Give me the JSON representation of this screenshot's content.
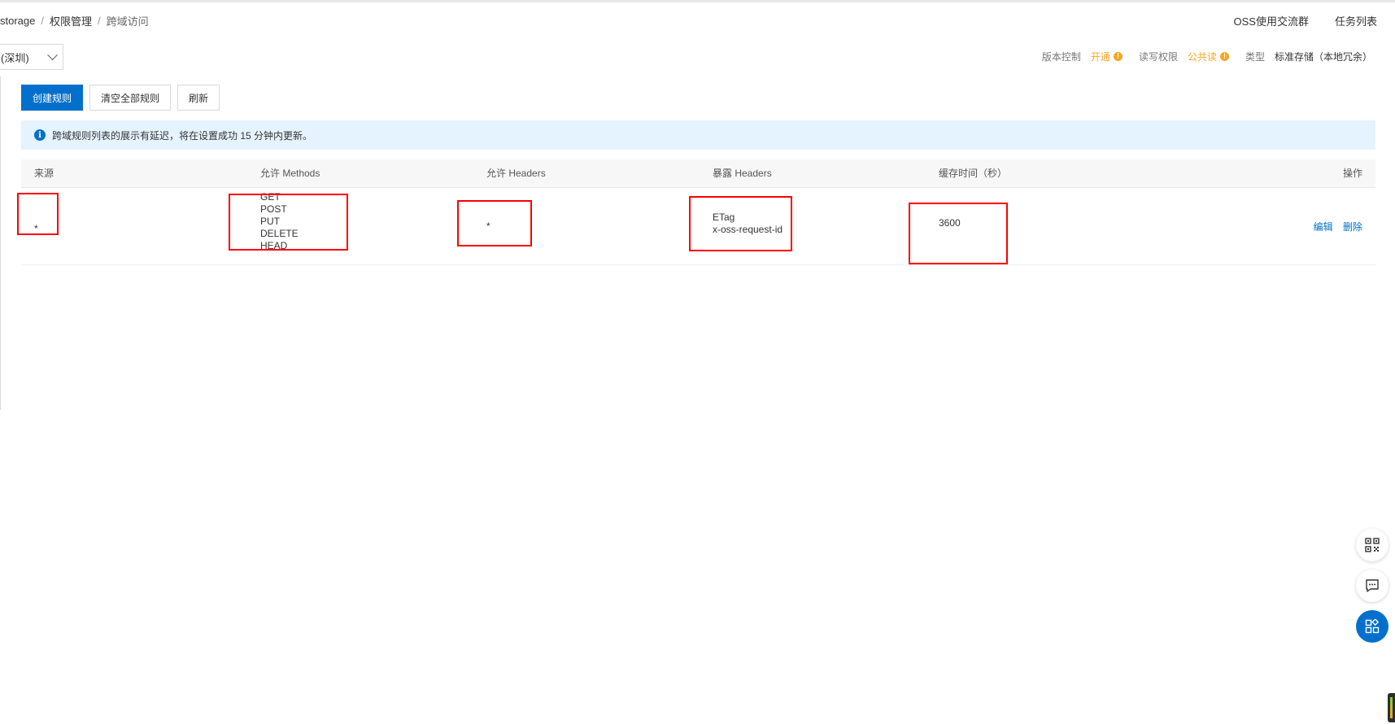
{
  "breadcrumb": [
    "storage",
    "权限管理",
    "跨域访问"
  ],
  "breadcrumb_separator": "/",
  "top_links": [
    "OSS使用交流群",
    "任务列表"
  ],
  "region_select": {
    "value": "(深圳)"
  },
  "bucket_meta": {
    "versioning_label": "版本控制",
    "versioning_value": "开通",
    "acl_label": "读写权限",
    "acl_value": "公共读",
    "type_label": "类型",
    "type_value": "标准存储（本地冗余）",
    "warn_glyph": "!"
  },
  "toolbar": {
    "create_label": "创建规则",
    "clear_label": "清空全部规则",
    "refresh_label": "刷新"
  },
  "notice": {
    "icon_glyph": "i",
    "text": "跨域规则列表的展示有延迟，将在设置成功 15 分钟内更新。"
  },
  "table": {
    "headers": {
      "source": "来源",
      "methods": "允许 Methods",
      "allow_headers": "允许 Headers",
      "expose_headers": "暴露 Headers",
      "max_age": "缓存时间（秒）",
      "actions": "操作"
    },
    "rows": [
      {
        "source": "*",
        "methods": [
          "GET",
          "POST",
          "PUT",
          "DELETE",
          "HEAD"
        ],
        "allow_headers": "*",
        "expose_headers": [
          "ETag",
          "x-oss-request-id"
        ],
        "max_age": "3600",
        "edit_label": "编辑",
        "delete_label": "删除"
      }
    ]
  },
  "colors": {
    "primary": "#0070cc",
    "warning": "#f5a623",
    "annotation": "#ff0000",
    "notice_bg": "#e5f3ff"
  },
  "floating_buttons": [
    "qr-code-icon",
    "chat-icon",
    "apps-icon"
  ]
}
